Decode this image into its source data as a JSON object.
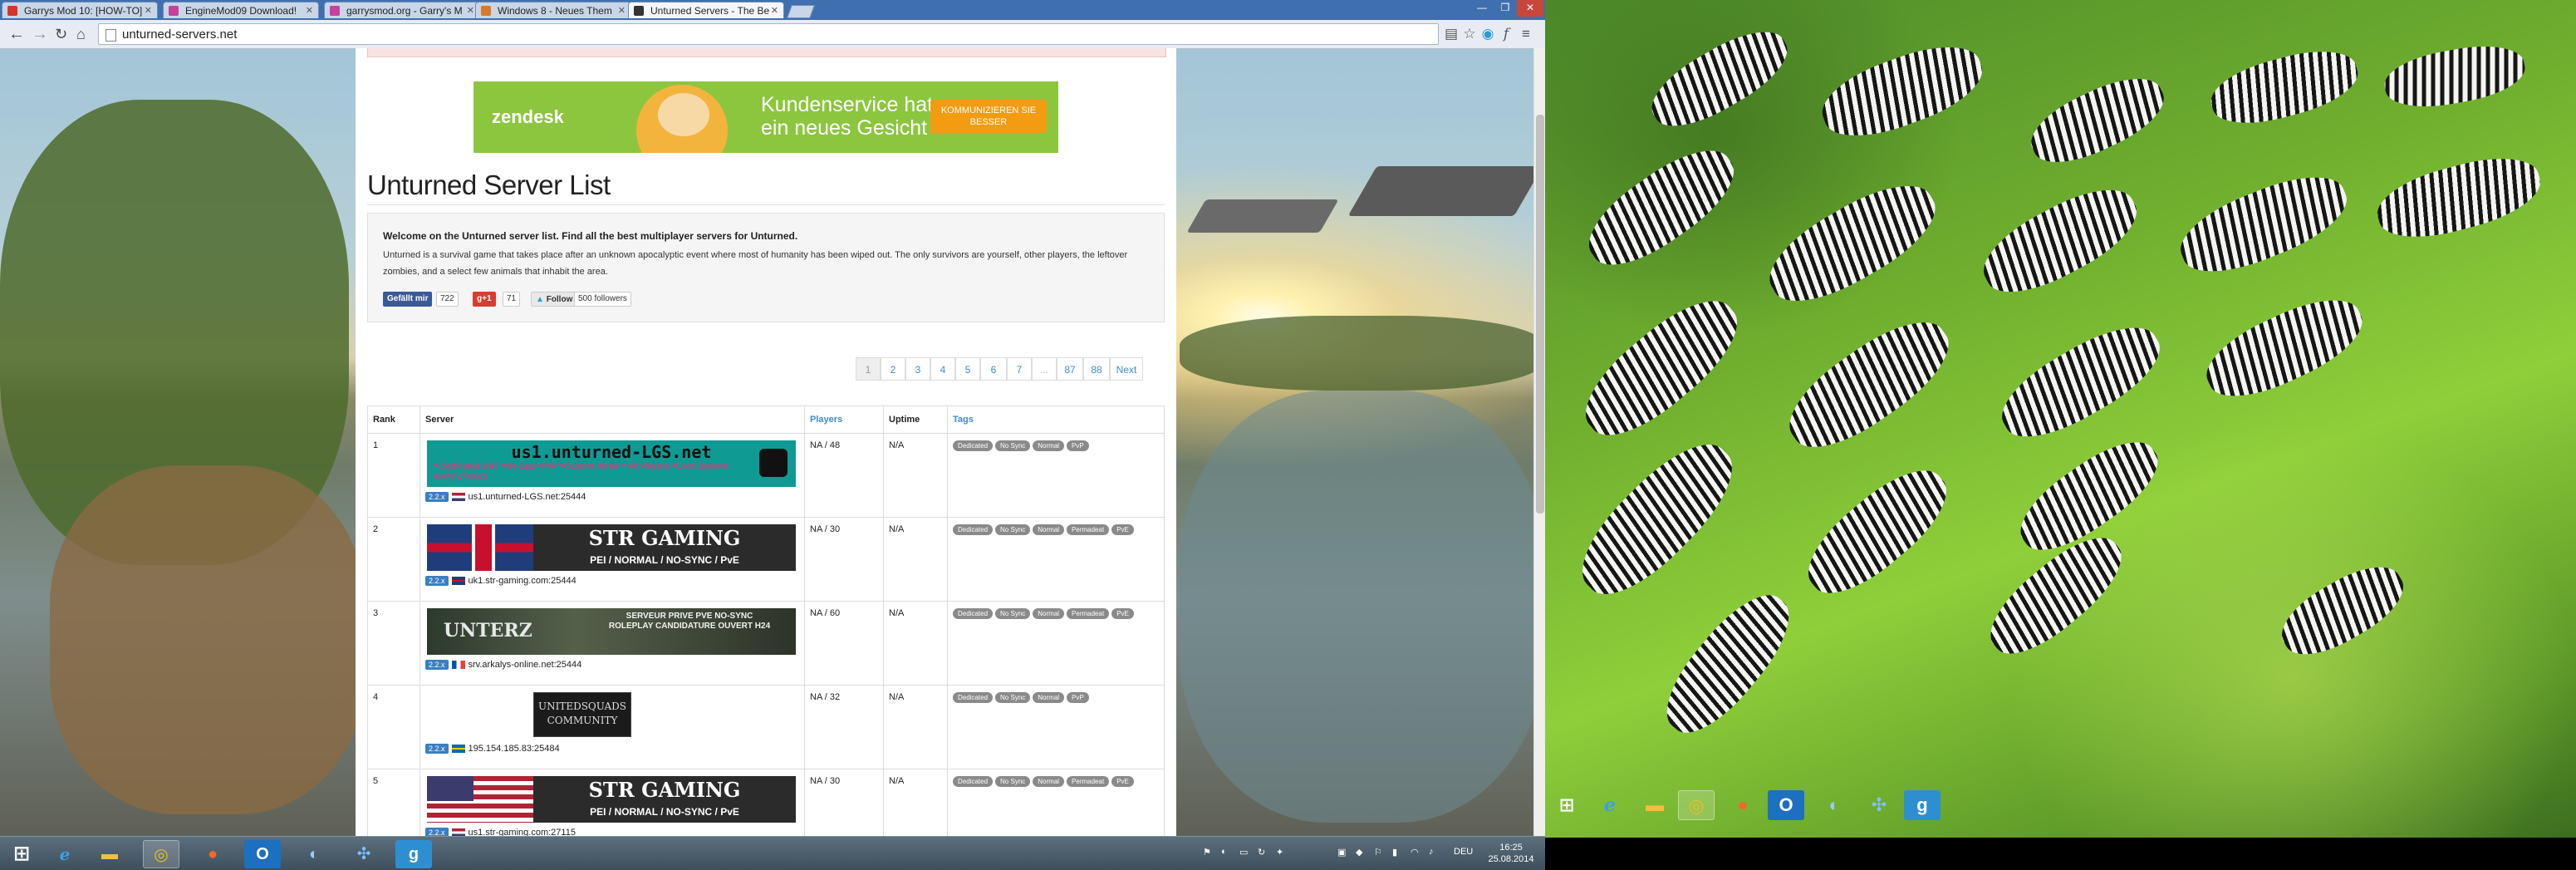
{
  "browser": {
    "tabs": [
      {
        "label": "Garrys Mod 10: [HOW-TO]",
        "favicon_color": "#d9342b"
      },
      {
        "label": "EngineMod09 Download!",
        "favicon_color": "#c7409b"
      },
      {
        "label": "garrysmod.org - Garry's M",
        "favicon_color": "#c7409b"
      },
      {
        "label": "Windows 8 - Neues Them",
        "favicon_color": "#d97a2b"
      },
      {
        "label": "Unturned Servers - The Be",
        "favicon_color": "#333333"
      }
    ],
    "url": "unturned-servers.net"
  },
  "ad": {
    "brand": "zendesk",
    "slogan_line1": "Kundenservice hat",
    "slogan_line2": "ein neues Gesicht",
    "cta": "KOMMUNIZIEREN SIE BESSER"
  },
  "page": {
    "title": "Unturned Server List",
    "intro_lead": "Welcome on the Unturned server list. Find all the best multiplayer servers for Unturned.",
    "intro_body": "Unturned is a survival game that takes place after an unknown apocalyptic event where most of humanity has been wiped out. The only survivors are yourself, other players, the leftover zombies, and a select few animals that inhabit the area.",
    "facebook_label": "Gefällt mir",
    "facebook_count": "722",
    "gplus_label": "g+1",
    "gplus_count": "71",
    "twitter_label": "Follow",
    "twitter_count": "500 followers"
  },
  "pagination": [
    "1",
    "2",
    "3",
    "4",
    "5",
    "6",
    "7",
    "...",
    "87",
    "88",
    "Next"
  ],
  "table": {
    "headers": {
      "rank": "Rank",
      "server": "Server",
      "players": "Players",
      "uptime": "Uptime",
      "tags": "Tags"
    },
    "rows": [
      {
        "rank": "1",
        "banner": "us1.unturned-LGS.net",
        "banner_sub": "= Dedicated 24/7 =No Lag =PvP =Custom Mods = 48 Players =Loot Spawns every 2 hours",
        "version": "2.2.x",
        "address": "us1.unturned-LGS.net:25444",
        "players": "NA / 48",
        "uptime": "N/A",
        "tags": [
          "Dedicated",
          "No Sync",
          "Normal",
          "PvP"
        ]
      },
      {
        "rank": "2",
        "banner": "STR GAMING",
        "banner_sub": "PEI / NORMAL / NO-SYNC / PvE",
        "version": "2.2.x",
        "address": "uk1.str-gaming.com:25444",
        "players": "NA / 30",
        "uptime": "N/A",
        "tags": [
          "Dedicated",
          "No Sync",
          "Normal",
          "Permadeat",
          "PvE"
        ]
      },
      {
        "rank": "3",
        "banner": "UNTERZ",
        "banner_sub": "SERVEUR PRIVE PVE NO-SYNC ROLEPLAY CANDIDATURE OUVERT H24",
        "version": "2.2.x",
        "address": "srv.arkalys-online.net:25444",
        "players": "NA / 60",
        "uptime": "N/A",
        "tags": [
          "Dedicated",
          "No Sync",
          "Normal",
          "Permadeat",
          "PvE"
        ]
      },
      {
        "rank": "4",
        "banner": "UNITEDSQUADS COMMUNITY",
        "banner_sub": "",
        "version": "2.2.x",
        "address": "195.154.185.83:25484",
        "players": "NA / 32",
        "uptime": "N/A",
        "tags": [
          "Dedicated",
          "No Sync",
          "Normal",
          "PvP"
        ]
      },
      {
        "rank": "5",
        "banner": "STR GAMING",
        "banner_sub": "PEI / NORMAL / NO-SYNC / PvE",
        "version": "2.2.x",
        "address": "us1.str-gaming.com:27115",
        "players": "NA / 30",
        "uptime": "N/A",
        "tags": [
          "Dedicated",
          "No Sync",
          "Normal",
          "Permadeat",
          "PvE"
        ]
      }
    ]
  },
  "taskbar": {
    "clock_time": "16:25",
    "clock_date": "25.08.2014",
    "language": "DEU"
  },
  "colors": {
    "link": "#428bca",
    "ad_green": "#8cc63f",
    "tag_grey": "#8a8a8a"
  }
}
